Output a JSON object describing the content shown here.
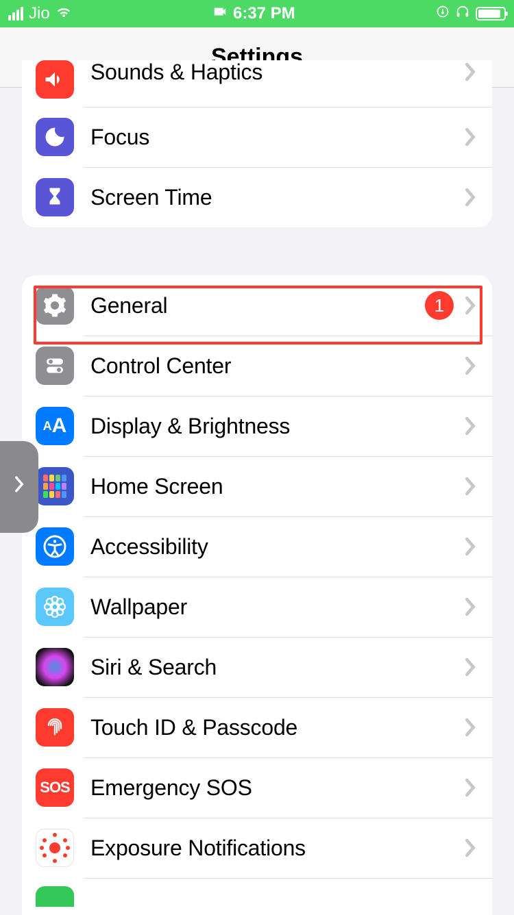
{
  "status": {
    "carrier": "Jio",
    "time": "6:37 PM"
  },
  "nav": {
    "title": "Settings"
  },
  "group1": {
    "sounds": "Sounds & Haptics",
    "focus": "Focus",
    "screenTime": "Screen Time"
  },
  "group2": {
    "general": "General",
    "generalBadge": "1",
    "controlCenter": "Control Center",
    "display": "Display & Brightness",
    "homeScreen": "Home Screen",
    "accessibility": "Accessibility",
    "wallpaper": "Wallpaper",
    "siri": "Siri & Search",
    "touchId": "Touch ID & Passcode",
    "sosText": "SOS",
    "emergencySos": "Emergency SOS",
    "exposure": "Exposure Notifications"
  }
}
